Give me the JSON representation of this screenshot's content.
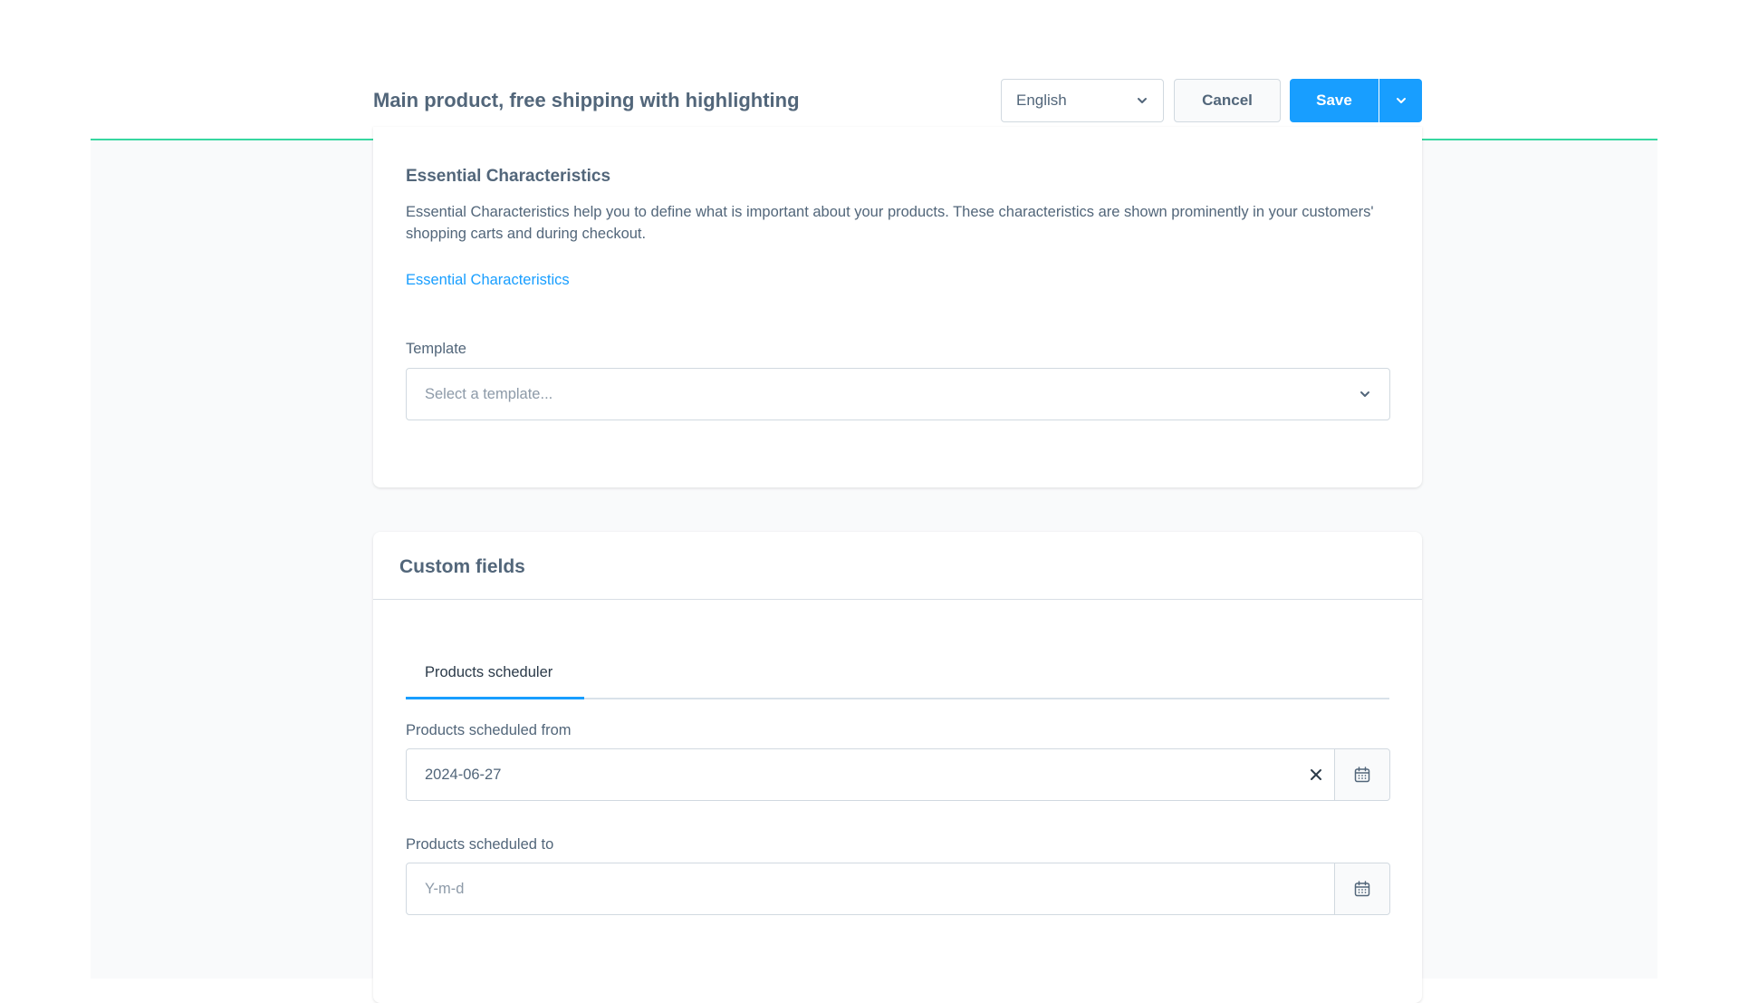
{
  "header": {
    "title": "Main product, free shipping with highlighting",
    "language_select": {
      "value": "English"
    },
    "cancel_label": "Cancel",
    "save_label": "Save"
  },
  "essential_characteristics": {
    "heading": "Essential Characteristics",
    "description": "Essential Characteristics help you to define what is important about your products. These characteristics are shown prominently in your customers' shopping carts and during checkout.",
    "link_text": "Essential Characteristics",
    "template_label": "Template",
    "template_placeholder": "Select a template..."
  },
  "custom_fields": {
    "heading": "Custom fields",
    "tabs": [
      {
        "label": "Products scheduler",
        "active": true
      }
    ],
    "scheduled_from": {
      "label": "Products scheduled from",
      "value": "2024-06-27",
      "placeholder": "Y-m-d"
    },
    "scheduled_to": {
      "label": "Products scheduled to",
      "value": "",
      "placeholder": "Y-m-d"
    }
  },
  "colors": {
    "primary": "#189eff",
    "header_underline": "#37d7a0",
    "text": "#52667a",
    "page_background": "#f9fafb"
  },
  "icons": {
    "language_dropdown": "chevron-down-icon",
    "save_dropdown": "chevron-down-icon",
    "template_dropdown": "chevron-down-icon",
    "clear": "close-icon",
    "calendar": "calendar-icon"
  }
}
